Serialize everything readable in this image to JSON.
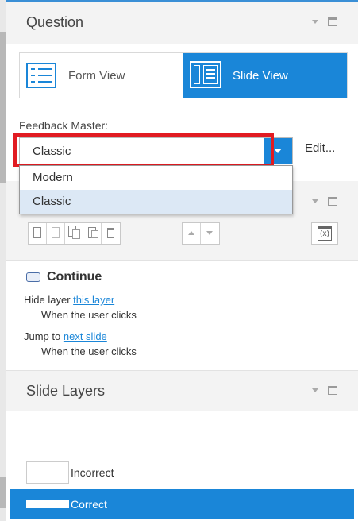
{
  "question_panel": {
    "title": "Question",
    "form_view_label": "Form View",
    "slide_view_label": "Slide View"
  },
  "feedback": {
    "label": "Feedback Master:",
    "selected": "Classic",
    "options": [
      "Modern",
      "Classic"
    ],
    "edit_label": "Edit..."
  },
  "triggers": {
    "button_name": "Continue",
    "actions": [
      {
        "prefix": "Hide layer ",
        "link": "this layer",
        "condition": "When the user clicks"
      },
      {
        "prefix": "Jump to ",
        "link": "next slide",
        "condition": "When the user clicks"
      }
    ],
    "variable_icon": "(x)"
  },
  "layers_panel": {
    "title": "Slide Layers",
    "layers": [
      {
        "name": "Incorrect",
        "selected": false
      },
      {
        "name": "Correct",
        "selected": true
      }
    ]
  },
  "colors": {
    "accent": "#1a86d8",
    "highlight_border": "#e11b22",
    "panel_bg": "#f3f3f3"
  }
}
